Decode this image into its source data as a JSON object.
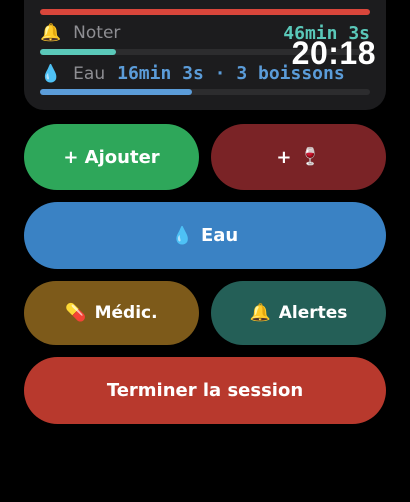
{
  "status": {
    "top_bar_color": "#d9463b",
    "noter": {
      "icon": "bell-icon",
      "icon_glyph": "🔔",
      "label": "Noter",
      "value": "46min 3s",
      "progress_fraction": 0.23,
      "color": "#5ac8b9"
    },
    "eau": {
      "icon": "water-drop-icon",
      "icon_glyph": "💧",
      "label": "Eau",
      "value": "16min 3s · 3 boissons",
      "progress_fraction": 0.46,
      "color": "#5b9cd9"
    }
  },
  "clock": "20:18",
  "buttons": {
    "add": {
      "label": "+ Ajouter",
      "color": "#2ea75a"
    },
    "add_wine": {
      "plus": "+",
      "icon": "wine-glass-icon",
      "icon_glyph": "🍷",
      "color": "#7a2326"
    },
    "water": {
      "icon": "water-drop-icon",
      "icon_glyph": "💧",
      "label": "Eau",
      "color": "#3a82c4"
    },
    "meds": {
      "icon": "pill-icon",
      "icon_glyph": "💊",
      "label": "Médic.",
      "color": "#7d5a1a"
    },
    "alerts": {
      "icon": "bell-icon",
      "icon_glyph": "🔔",
      "label": "Alertes",
      "color": "#245f57"
    },
    "end": {
      "label": "Terminer la session",
      "color": "#b8392d"
    }
  }
}
